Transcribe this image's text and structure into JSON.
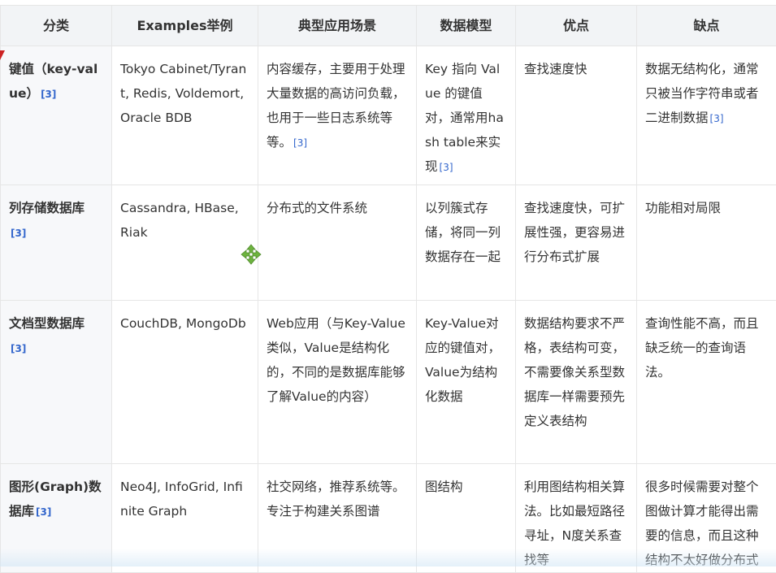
{
  "headers": [
    "分类",
    "Examples举例",
    "典型应用场景",
    "数据模型",
    "优点",
    "缺点"
  ],
  "rows": [
    {
      "category": "键值（key-value）",
      "category_ref": "[3]",
      "examples": "Tokyo Cabinet/Tyrant, Redis, Voldemort, Oracle BDB",
      "scenario": "内容缓存，主要用于处理大量数据的高访问负载，也用于一些日志系统等等。",
      "scenario_ref": "[3]",
      "model": "Key 指向 Value 的键值对，通常用hash table来实现",
      "model_ref": "[3]",
      "pros": "查找速度快",
      "cons": "数据无结构化，通常只被当作字符串或者二进制数据",
      "cons_ref": "[3]"
    },
    {
      "category": "列存储数据库",
      "category_ref": "[3]",
      "examples": "Cassandra, HBase, Riak",
      "scenario": "分布式的文件系统",
      "model": "以列簇式存储，将同一列数据存在一起",
      "pros": "查找速度快，可扩展性强，更容易进行分布式扩展",
      "cons": "功能相对局限"
    },
    {
      "category": "文档型数据库",
      "category_ref": "[3]",
      "examples": "CouchDB, MongoDb",
      "scenario": "Web应用（与Key-Value类似，Value是结构化的，不同的是数据库能够了解Value的内容）",
      "model": "Key-Value对应的键值对，Value为结构化数据",
      "pros": "数据结构要求不严格，表结构可变，不需要像关系型数据库一样需要预先定义表结构",
      "cons": "查询性能不高，而且缺乏统一的查询语法。"
    },
    {
      "category": "图形(Graph)数据库",
      "category_ref": "[3]",
      "examples": "Neo4J, InfoGrid, Infinite Graph",
      "scenario": "社交网络，推荐系统等。专注于构建关系图谱",
      "model": "图结构",
      "pros": "利用图结构相关算法。比如最短路径寻址，N度关系查找等",
      "cons": "很多时候需要对整个图做计算才能得出需要的信息，而且这种结构不太好做分布式"
    }
  ],
  "icons": {
    "cursor": "cursor-arrow-icon",
    "move": "move-cursor-icon",
    "move_color": "#6db33f"
  }
}
